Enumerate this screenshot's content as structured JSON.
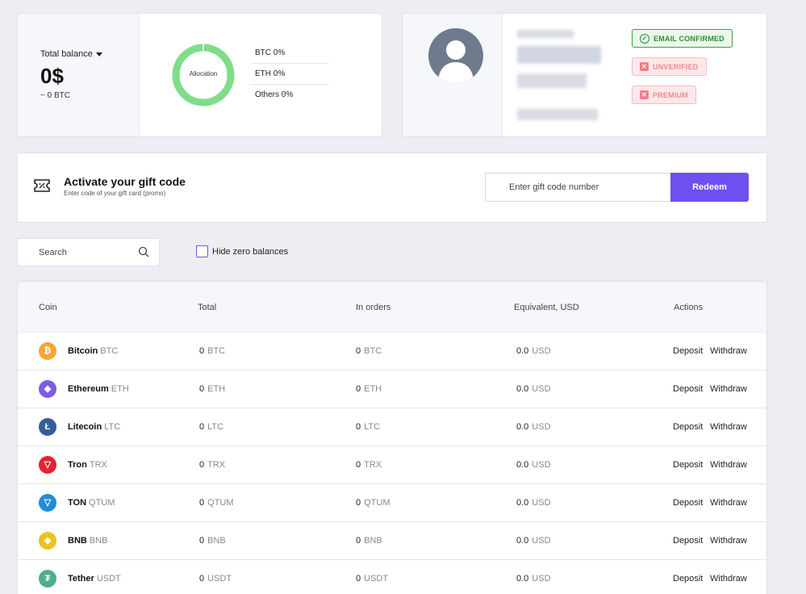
{
  "balance": {
    "label": "Total balance",
    "amount": "0$",
    "btc_equiv": "~ 0 BTC",
    "donut_label": "Allocation",
    "allocation": [
      {
        "label": "BTC 0%"
      },
      {
        "label": "ETH 0%"
      },
      {
        "label": "Others 0%"
      }
    ],
    "donut_color": "#7fdd8a"
  },
  "profile": {
    "badges": {
      "email": "EMAIL CONFIRMED",
      "verify": "UNVERIFIED",
      "premium": "PREMIUM"
    }
  },
  "gift": {
    "title": "Activate your gift code",
    "subtitle": "Enter code of your gift card (promo)",
    "placeholder": "Enter gift code number",
    "button": "Redeem"
  },
  "filters": {
    "search_placeholder": "Search",
    "hide_zero_label": "Hide zero balances"
  },
  "table": {
    "headers": {
      "coin": "Coin",
      "total": "Total",
      "in_orders": "In orders",
      "equivalent": "Equivalent, USD",
      "actions": "Actions"
    },
    "rows": [
      {
        "name": "Bitcoin",
        "symbol": "BTC",
        "total": "0",
        "total_unit": "BTC",
        "orders": "0",
        "orders_unit": "BTC",
        "usd": "0.0",
        "usd_unit": "USD",
        "deposit": "Deposit",
        "withdraw": "Withdraw",
        "icon": "bitcoin-icon",
        "color": "#f7a634",
        "glyph": "₿"
      },
      {
        "name": "Ethereum",
        "symbol": "ETH",
        "total": "0",
        "total_unit": "ETH",
        "orders": "0",
        "orders_unit": "ETH",
        "usd": "0.0",
        "usd_unit": "USD",
        "deposit": "Deposit",
        "withdraw": "Withdraw",
        "icon": "ethereum-icon",
        "color": "#7b5de0",
        "glyph": "◆"
      },
      {
        "name": "Litecoin",
        "symbol": "LTC",
        "total": "0",
        "total_unit": "LTC",
        "orders": "0",
        "orders_unit": "LTC",
        "usd": "0.0",
        "usd_unit": "USD",
        "deposit": "Deposit",
        "withdraw": "Withdraw",
        "icon": "litecoin-icon",
        "color": "#345d9d",
        "glyph": "Ł"
      },
      {
        "name": "Tron",
        "symbol": "TRX",
        "total": "0",
        "total_unit": "TRX",
        "orders": "0",
        "orders_unit": "TRX",
        "usd": "0.0",
        "usd_unit": "USD",
        "deposit": "Deposit",
        "withdraw": "Withdraw",
        "icon": "tron-icon",
        "color": "#e52330",
        "glyph": "▽"
      },
      {
        "name": "TON",
        "symbol": "QTUM",
        "total": "0",
        "total_unit": "QTUM",
        "orders": "0",
        "orders_unit": "QTUM",
        "usd": "0.0",
        "usd_unit": "USD",
        "deposit": "Deposit",
        "withdraw": "Withdraw",
        "icon": "ton-icon",
        "color": "#1d8fd8",
        "glyph": "▽"
      },
      {
        "name": "BNB",
        "symbol": "BNB",
        "total": "0",
        "total_unit": "BNB",
        "orders": "0",
        "orders_unit": "BNB",
        "usd": "0.0",
        "usd_unit": "USD",
        "deposit": "Deposit",
        "withdraw": "Withdraw",
        "icon": "bnb-icon",
        "color": "#f0c020",
        "glyph": "◈"
      },
      {
        "name": "Tether",
        "symbol": "USDT",
        "total": "0",
        "total_unit": "USDT",
        "orders": "0",
        "orders_unit": "USDT",
        "usd": "0.0",
        "usd_unit": "USD",
        "deposit": "Deposit",
        "withdraw": "Withdraw",
        "icon": "tether-icon",
        "color": "#4caf8e",
        "glyph": "₮"
      }
    ]
  }
}
